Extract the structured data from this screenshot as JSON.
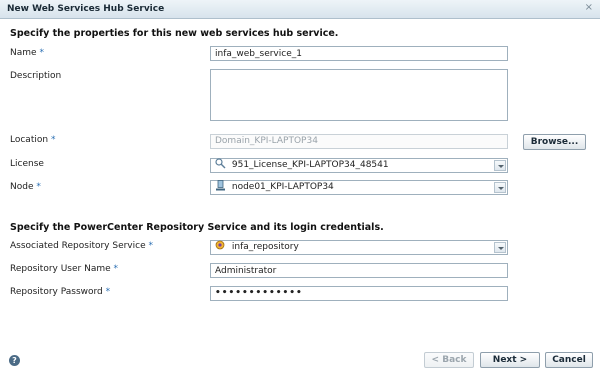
{
  "dialog": {
    "title": "New Web Services Hub Service",
    "close_glyph": "×"
  },
  "section1": {
    "heading": "Specify the properties for this new web services hub service."
  },
  "fields": {
    "name": {
      "label": "Name",
      "required": "*",
      "value": "infa_web_service_1"
    },
    "description": {
      "label": "Description",
      "value": ""
    },
    "location": {
      "label": "Location",
      "required": "*",
      "value": "Domain_KPI-LAPTOP34"
    },
    "license": {
      "label": "License",
      "value": "951_License_KPI-LAPTOP34_48541",
      "icon": "license-icon"
    },
    "node": {
      "label": "Node",
      "required": "*",
      "value": "node01_KPI-LAPTOP34",
      "icon": "node-icon"
    }
  },
  "browse_label": "Browse...",
  "section2": {
    "heading": "Specify the PowerCenter Repository Service and its login credentials."
  },
  "repo": {
    "service": {
      "label": "Associated Repository Service",
      "required": "*",
      "value": "infa_repository",
      "icon": "repository-icon"
    },
    "user": {
      "label": "Repository User Name",
      "required": "*",
      "value": "Administrator"
    },
    "password": {
      "label": "Repository Password",
      "required": "*",
      "value": "•••••••••••••"
    }
  },
  "footer": {
    "help_glyph": "?",
    "back_label": "< Back",
    "next_label": "Next >",
    "cancel_label": "Cancel"
  },
  "colors": {
    "required_marker": "#2a6fb3",
    "title_bar": "#d7e3ec"
  }
}
